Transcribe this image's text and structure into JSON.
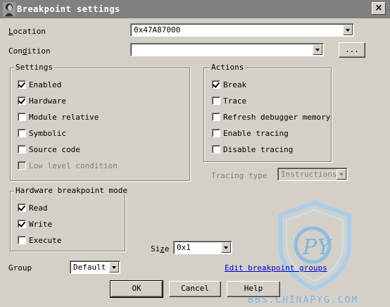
{
  "window": {
    "title": "Breakpoint settings",
    "close": "×"
  },
  "location": {
    "label": "Location",
    "value": "0x47A87000"
  },
  "condition": {
    "label": "Condition",
    "value": "",
    "browse_label": "..."
  },
  "settings": {
    "title": "Settings",
    "items": [
      {
        "label": "Enabled",
        "checked": true,
        "disabled": false
      },
      {
        "label": "Hardware",
        "checked": true,
        "disabled": false
      },
      {
        "label": "Module relative",
        "checked": false,
        "disabled": false
      },
      {
        "label": "Symbolic",
        "checked": false,
        "disabled": false
      },
      {
        "label": "Source code",
        "checked": false,
        "disabled": false
      },
      {
        "label": "Low level condition",
        "checked": false,
        "disabled": true
      }
    ]
  },
  "actions": {
    "title": "Actions",
    "items": [
      {
        "label": "Break",
        "checked": true
      },
      {
        "label": "Trace",
        "checked": false
      },
      {
        "label": "Refresh debugger memory",
        "checked": false
      },
      {
        "label": "Enable tracing",
        "checked": false
      },
      {
        "label": "Disable tracing",
        "checked": false
      }
    ]
  },
  "tracing": {
    "label": "Tracing type",
    "value": "Instructions"
  },
  "hw_mode": {
    "title": "Hardware breakpoint mode",
    "items": [
      {
        "label": "Read",
        "checked": true
      },
      {
        "label": "Write",
        "checked": true
      },
      {
        "label": "Execute",
        "checked": false
      }
    ]
  },
  "size": {
    "label": "Size",
    "value": "0x1"
  },
  "group": {
    "label": "Group",
    "value": "Default",
    "edit_link": "Edit breakpoint groups"
  },
  "buttons": {
    "ok": "OK",
    "cancel": "Cancel",
    "help": "Help"
  },
  "watermark": {
    "text": "BBS.CHINAPYG.COM",
    "logo_text": "PY"
  }
}
